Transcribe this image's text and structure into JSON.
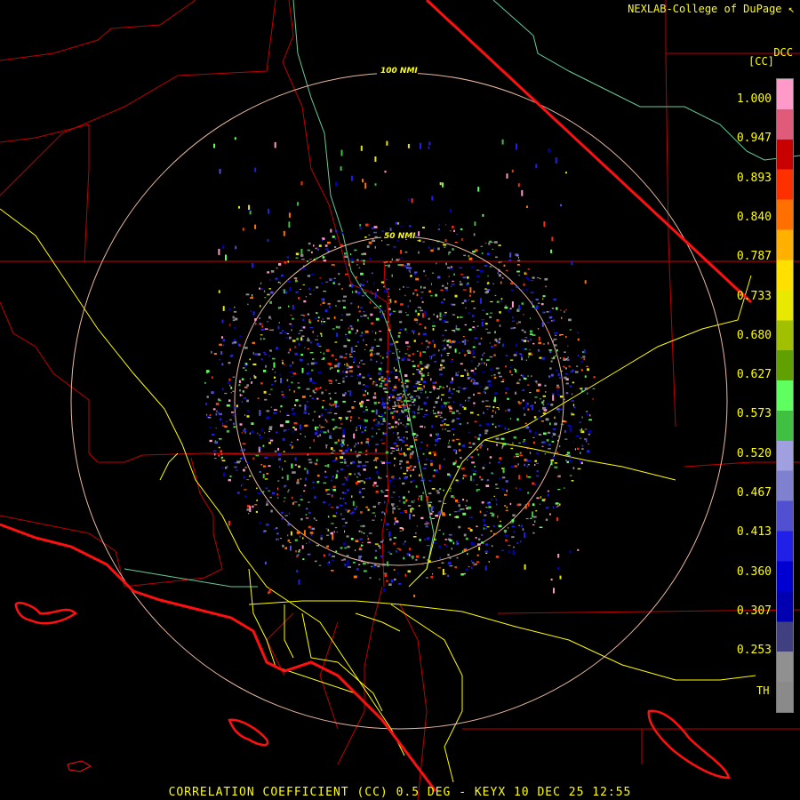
{
  "credit": "NEXLAB-College of DuPage",
  "credit_icon": "cursor-arrow-icon",
  "product_code": "DCC",
  "unit_label": "[CC]",
  "colorbar": {
    "ticks": [
      "1.000",
      "0.947",
      "0.893",
      "0.840",
      "0.787",
      "0.733",
      "0.680",
      "0.627",
      "0.573",
      "0.520",
      "0.467",
      "0.413",
      "0.360",
      "0.307",
      "0.253"
    ],
    "bottom_label": "TH",
    "colors": [
      "#ff9ac8",
      "#e05a7a",
      "#c80000",
      "#ff3000",
      "#ff7000",
      "#ffb000",
      "#ffe000",
      "#e8e800",
      "#a0c000",
      "#60a000",
      "#60ff60",
      "#40c040",
      "#a0a0e0",
      "#8080d0",
      "#5050d0",
      "#2020e8",
      "#0000d0",
      "#0000b0",
      "#404080",
      "#909090",
      "#8a8a8a"
    ]
  },
  "rings": {
    "outer_label": "100 NMI",
    "inner_label": "50 NMI"
  },
  "footer": "CORRELATION COEFFICIENT (CC) 0.5 DEG - KEYX 10 DEC 25 12:55",
  "colors": {
    "background": "#000000",
    "label": "#ffff00",
    "state_border": "#ff0000",
    "county_border": "#c00000",
    "highway": "#ffff00",
    "river": "#66cc99",
    "range_ring": "#e8b8a0"
  }
}
